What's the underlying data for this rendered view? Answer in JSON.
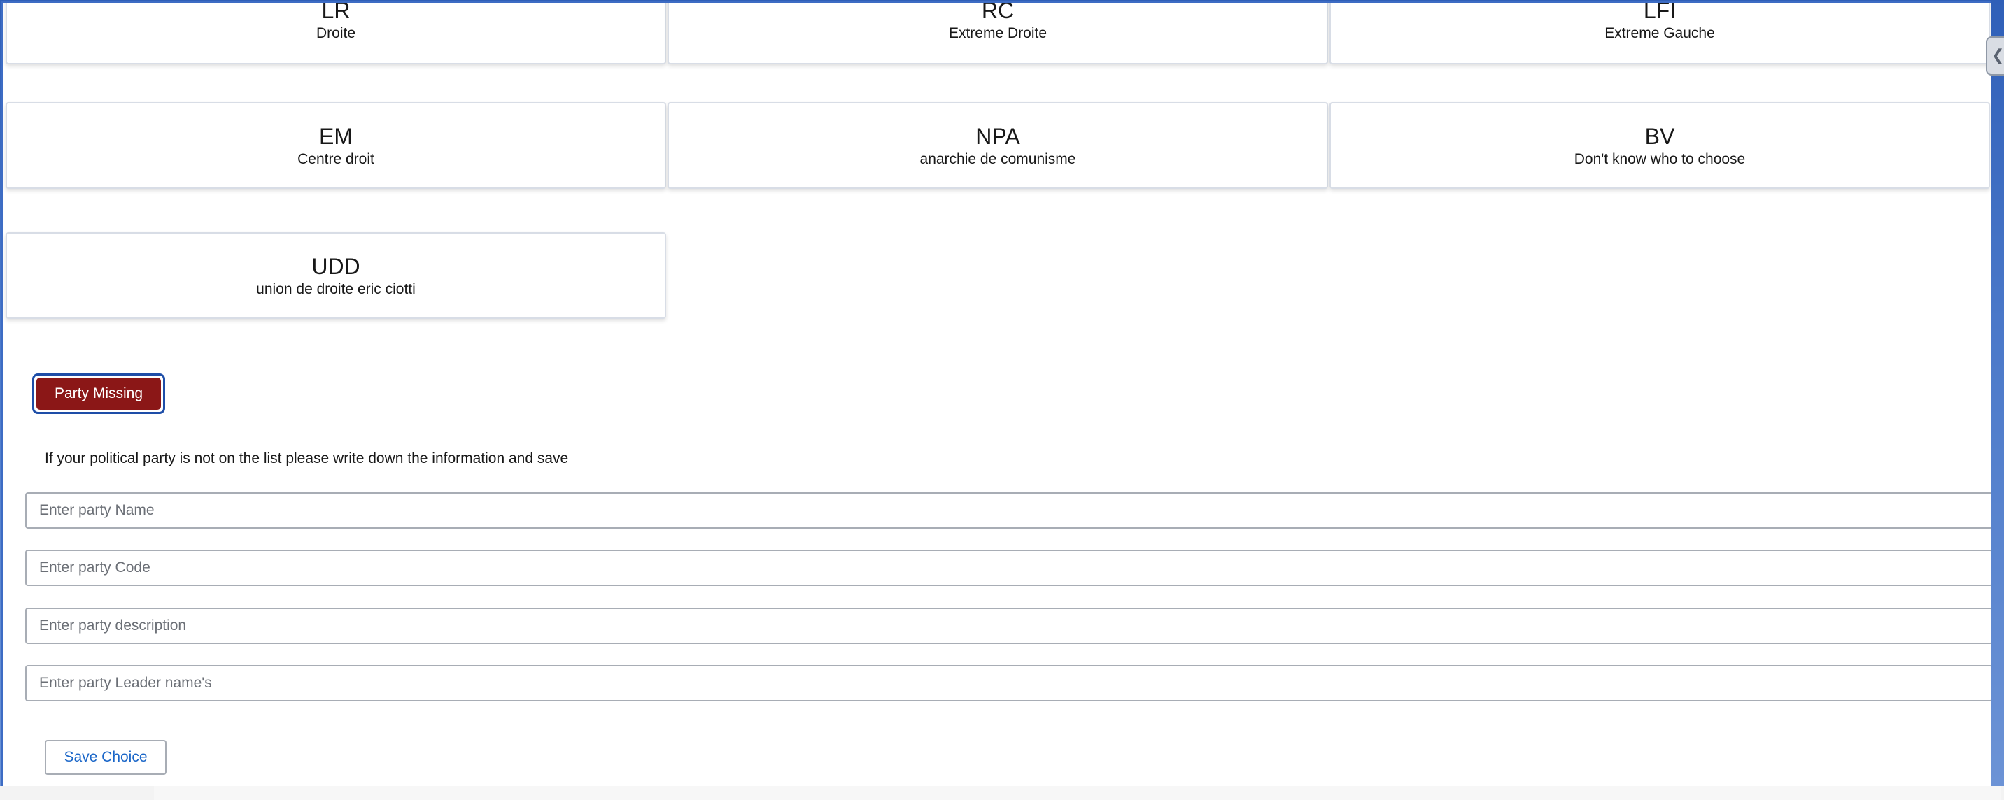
{
  "parties": [
    {
      "code": "LR",
      "description": "Droite"
    },
    {
      "code": "RC",
      "description": "Extreme Droite"
    },
    {
      "code": "LFI",
      "description": "Extreme Gauche"
    },
    {
      "code": "EM",
      "description": "Centre droit"
    },
    {
      "code": "NPA",
      "description": "anarchie de comunisme"
    },
    {
      "code": "BV",
      "description": "Don't know who to choose"
    },
    {
      "code": "UDD",
      "description": "union de droite eric ciotti"
    }
  ],
  "missing": {
    "button_label": "Party Missing",
    "hint": "If your political party is not on the list please write down the information and save"
  },
  "form": {
    "name_placeholder": "Enter party Name",
    "code_placeholder": "Enter party Code",
    "description_placeholder": "Enter party description",
    "leader_placeholder": "Enter party Leader name's",
    "save_label": "Save Choice"
  },
  "colors": {
    "missing_button": "#8b1717",
    "save_text": "#1a66c8",
    "frame_accent": "#3d6cc4"
  }
}
